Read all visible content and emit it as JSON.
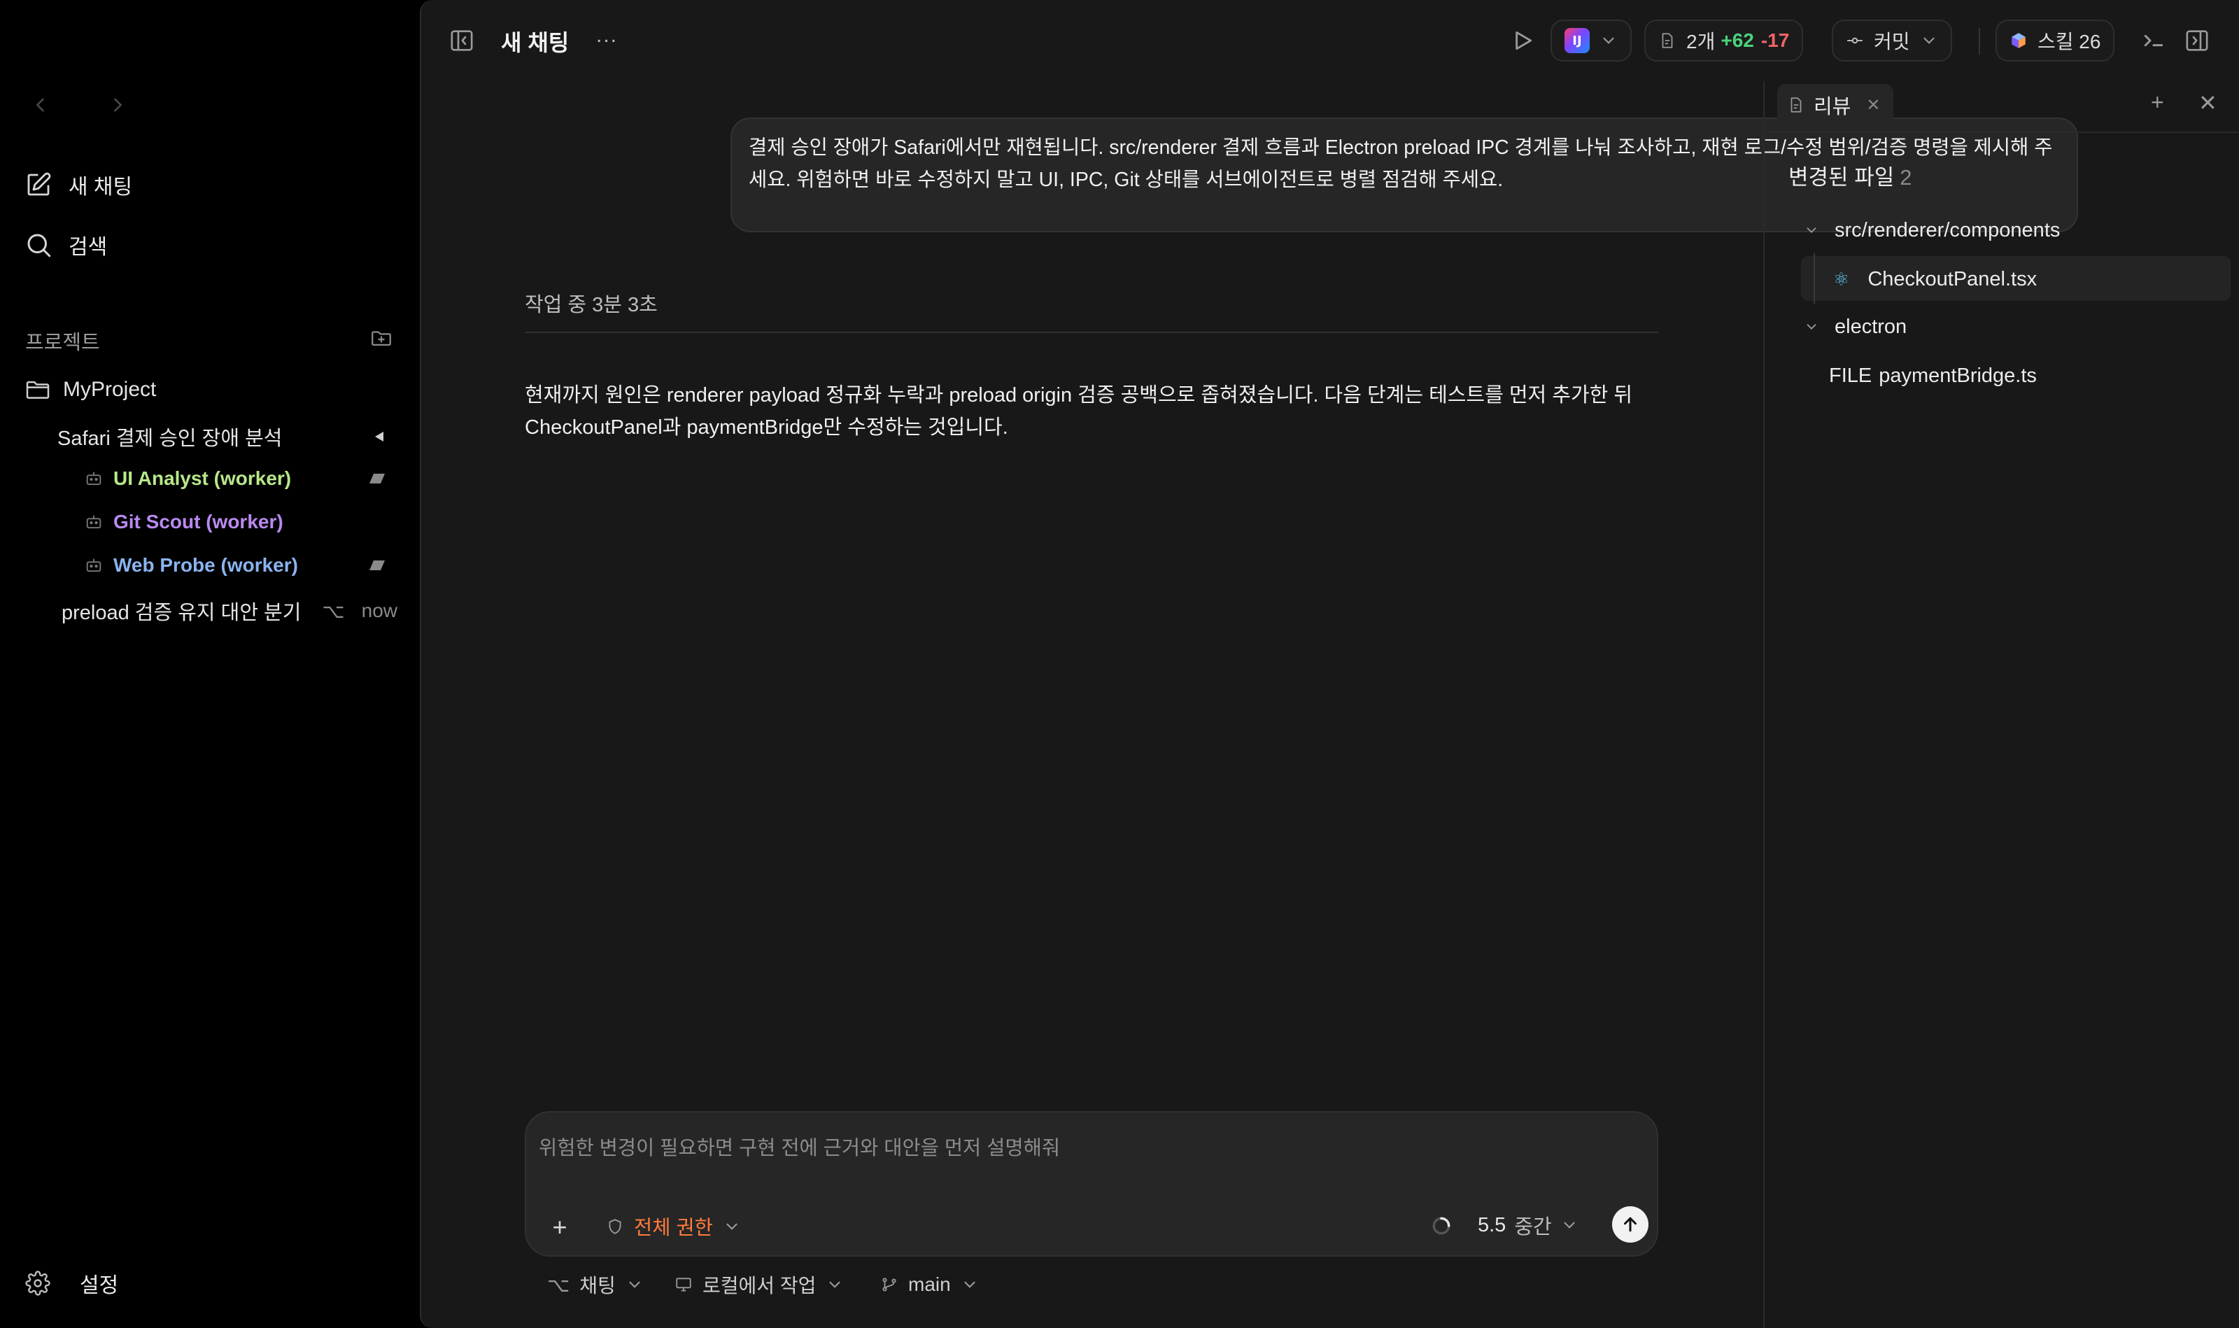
{
  "sidebar": {
    "new_chat": "새 채팅",
    "search": "검색",
    "projects_label": "프로젝트",
    "project_name": "MyProject",
    "thread_title": "Safari 결제 승인 장애 분석",
    "workers": [
      {
        "label": "UI Analyst (worker)",
        "color": "#b7e88a"
      },
      {
        "label": "Git Scout (worker)",
        "color": "#b98af0"
      },
      {
        "label": "Web Probe (worker)",
        "color": "#8ab4f0"
      }
    ],
    "branch_thread": "preload 검증 유지 대안 분기",
    "branch_icon": "⌥",
    "branch_time": "now",
    "settings": "설정"
  },
  "topbar": {
    "title": "새 채팅",
    "more": "...",
    "ide_badge": "IJ",
    "changes_count": "2개",
    "additions": "+62",
    "deletions": "-17",
    "commit_label": "커밋",
    "skills_label": "스킬 26"
  },
  "chat": {
    "user_message": "결제 승인 장애가 Safari에서만 재현됩니다. src/renderer 결제 흐름과 Electron preload IPC 경계를 나눠 조사하고, 재현 로그/수정 범위/검증 명령을 제시해 주세요. 위험하면 바로 수정하지 말고 UI, IPC, Git 상태를 서브에이전트로 병렬 점검해 주세요.",
    "status": "작업 중 3분 3초",
    "assistant_message": "현재까지 원인은 renderer payload 정규화 누락과 preload origin 검증 공백으로 좁혀졌습니다. 다음 단계는 테스트를 먼저 추가한 뒤 CheckoutPanel과 paymentBridge만 수정하는 것입니다."
  },
  "composer": {
    "placeholder": "위험한 변경이 필요하면 구현 전에 근거와 대안을 먼저 설명해줘",
    "permission": "전체 권한",
    "model_version": "5.5",
    "effort": "중간",
    "footer_chat": "채팅",
    "footer_local": "로컬에서 작업",
    "footer_branch": "main"
  },
  "review": {
    "tab_label": "리뷰",
    "changed_files_label": "변경된 파일",
    "changed_files_count": "2",
    "folder1": "src/renderer/components",
    "file1": "CheckoutPanel.tsx",
    "folder2": "electron",
    "file2_prefix": "FILE",
    "file2": "paymentBridge.ts"
  },
  "colors": {
    "accent_orange": "#ff7a3d",
    "additions_green": "#4bd37b",
    "deletions_red": "#f06464"
  }
}
